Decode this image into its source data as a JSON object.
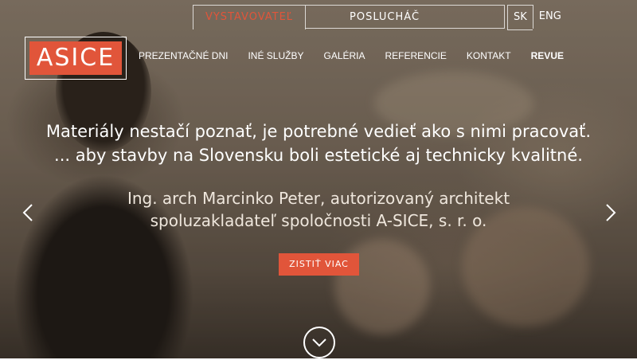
{
  "tabs": {
    "exhibitor": "VYSTAVOVATEĽ",
    "listener": "POSLUCHÁČ"
  },
  "languages": {
    "sk": "SK",
    "eng": "ENG"
  },
  "logo": {
    "text": "ASICE"
  },
  "nav": {
    "items": [
      "PREZENTAČNÉ DNI",
      "INÉ SLUŽBY",
      "GALÉRIA",
      "REFERENCIE",
      "KONTAKT",
      "REVUE"
    ]
  },
  "hero": {
    "headline_line1": "Materiály nestačí poznať, je potrebné vedieť ako s nimi pracovať.",
    "headline_line2": "... aby stavby na Slovensku boli estetické aj technicky kvalitné.",
    "author_line1": "Ing. arch Marcinko Peter, autorizovaný architekt",
    "author_line2": "spoluzakladateľ spoločnosti A-SICE, s. r. o.",
    "cta_label": "ZISTIŤ VIAC"
  },
  "icons": {
    "prev": "chevron-left-icon",
    "next": "chevron-right-icon",
    "scroll": "chevron-down-icon"
  },
  "colors": {
    "accent": "#e1553a"
  }
}
